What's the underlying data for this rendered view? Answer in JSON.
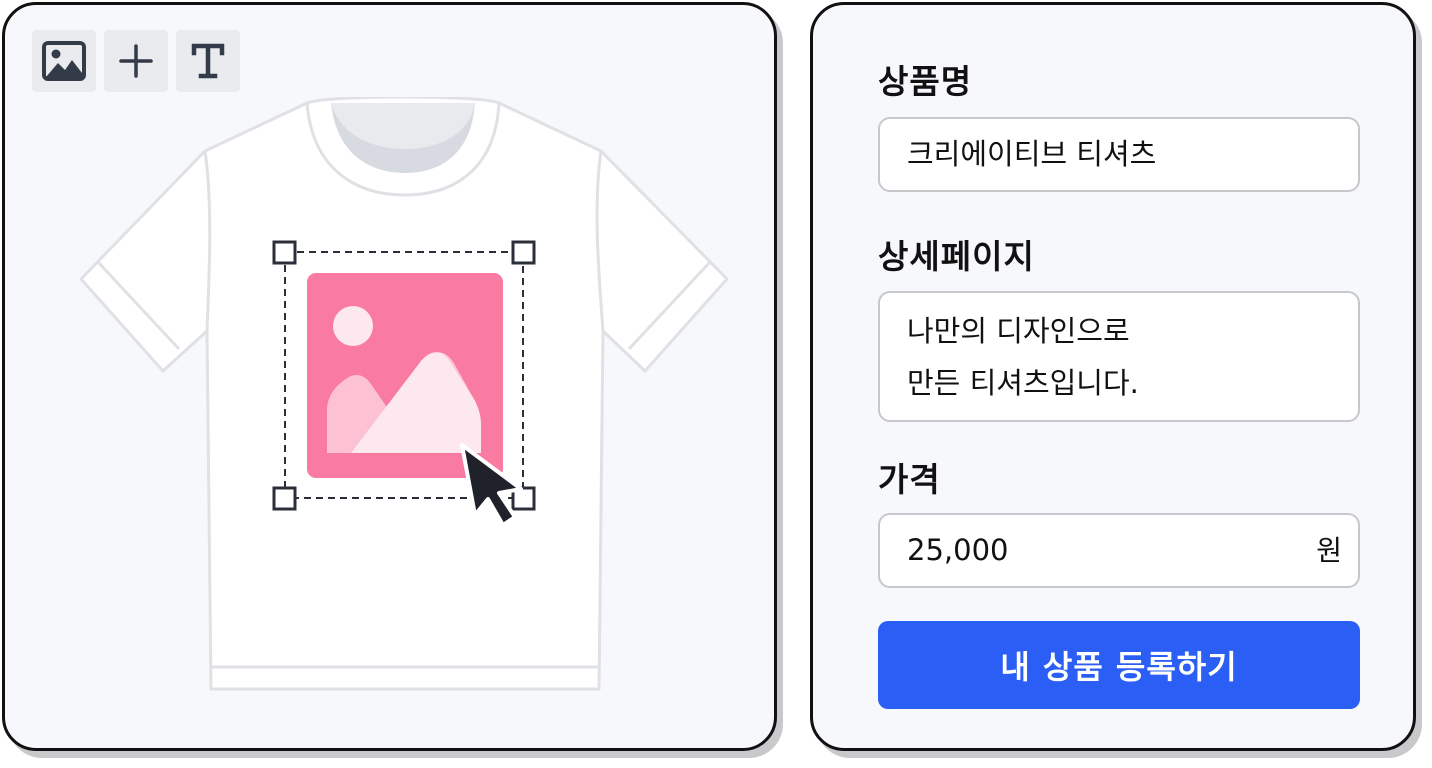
{
  "toolbar": {
    "tools": [
      {
        "icon": "image-icon",
        "label": "image"
      },
      {
        "icon": "plus-icon",
        "label": "add"
      },
      {
        "icon": "text-icon",
        "label": "text"
      }
    ]
  },
  "canvas": {
    "product": "t-shirt",
    "placed_image_icon": "image-placeholder-icon",
    "pointer_icon": "cursor-arrow-icon"
  },
  "form": {
    "name_label": "상품명",
    "name_value": "크리에이티브 티셔츠",
    "detail_label": "상세페이지",
    "detail_value": "나만의 디자인으로\n만든 티셔츠입니다.",
    "price_label": "가격",
    "price_value": "25,000",
    "price_unit": "원",
    "submit_label": "내 상품 등록하기"
  },
  "colors": {
    "accent": "#2b5ef5",
    "image_pink": "#f97ba1",
    "card_background": "#f7f8fb",
    "card_border": "#111111"
  }
}
